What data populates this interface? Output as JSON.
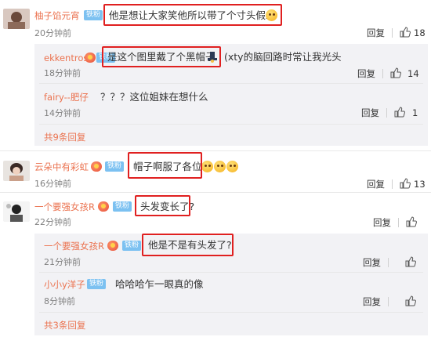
{
  "comments": [
    {
      "user": "柚子馅元宵",
      "badge": "铁粉",
      "text": "他是想让大家笑他所以带了个寸头假发",
      "time": "20分钟前",
      "reply": "回复",
      "likes": "18",
      "icons": [
        "vip-badge-icon",
        "surprised-emoji-icon"
      ]
    },
    {
      "user": "ekkentros",
      "badge": "铁粉",
      "text": "是这个图里戴了个黑帽子",
      "text_suffix": "(xty的脑回路时常让我光头",
      "time": "18分钟前",
      "reply": "回复",
      "likes": "14",
      "icons": [
        "vip-badge-icon",
        "hat-emoji-icon"
      ]
    },
    {
      "user": "fairy--肥仔",
      "text": "？？？这位姐妹在想什么",
      "time": "14分钟前",
      "reply": "回复",
      "likes": "1"
    },
    {
      "more": "共9条回复"
    },
    {
      "user": "云朵中有彩虹",
      "badge": "铁粉",
      "text": "帽子啊服了各位",
      "time": "16分钟前",
      "reply": "回复",
      "likes": "13",
      "icons": [
        "vip-badge-icon",
        "laughing-emoji-icon"
      ]
    },
    {
      "user": "一个要强女孩R",
      "badge": "铁粉",
      "text": "头发变长了?",
      "time": "22分钟前",
      "reply": "回复",
      "likes": "",
      "icons": [
        "vip-badge-icon",
        "wechat-badge-icon"
      ]
    },
    {
      "user": "一个要强女孩R",
      "badge": "铁粉",
      "text": "他是不是有头发了?",
      "time": "21分钟前",
      "reply": "回复",
      "likes": "",
      "icons": [
        "vip-badge-icon",
        "wechat-badge-icon"
      ]
    },
    {
      "user": "小小y洋子",
      "badge": "铁粉",
      "text": "哈哈哈乍一眼真的像",
      "time": "8分钟前",
      "reply": "回复",
      "likes": ""
    },
    {
      "more": "共3条回复"
    }
  ],
  "colors": {
    "username": "#eb7350",
    "highlight_box": "#e02020",
    "badge": "#7cc1f1",
    "sub_background": "#f2f2f5"
  }
}
